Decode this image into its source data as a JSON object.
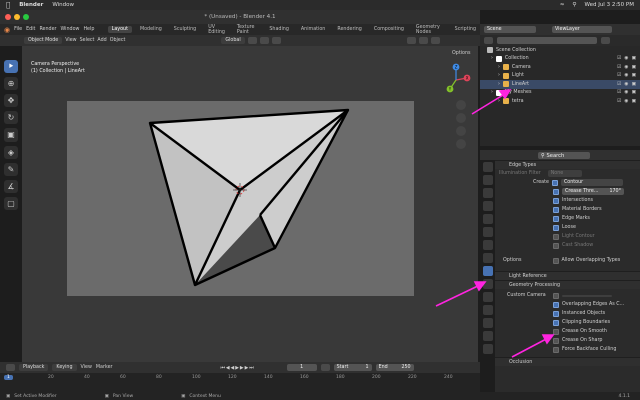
{
  "mac_menu": {
    "app": "Blender",
    "items": [
      "Window"
    ],
    "clock": "Wed Jul 3  2:50 PM"
  },
  "window": {
    "title": "* (Unsaved) - Blender 4.1"
  },
  "menubar": {
    "menus": [
      "File",
      "Edit",
      "Render",
      "Window",
      "Help"
    ],
    "workspaces": [
      "Layout",
      "Modeling",
      "Sculpting",
      "UV Editing",
      "Texture Paint",
      "Shading",
      "Animation",
      "Rendering",
      "Compositing",
      "Geometry Nodes",
      "Scripting"
    ],
    "active_workspace": "Layout",
    "scene": "Scene",
    "view_layer": "ViewLayer"
  },
  "viewport_header": {
    "mode": "Object Mode",
    "menus": [
      "View",
      "Select",
      "Add",
      "Object"
    ],
    "transform": "Global",
    "options": "Options"
  },
  "viewport": {
    "line1": "Camera Perspective",
    "line2": "(1) Collection | LineArt"
  },
  "gizmo": {
    "x": "X",
    "y": "Y",
    "z": "Z"
  },
  "timeline": {
    "menus": [
      "Playback",
      "Keying",
      "View",
      "Marker"
    ],
    "current_frame": "1",
    "start_label": "Start",
    "start": "1",
    "end_label": "End",
    "end": "250",
    "ticks": [
      "1",
      "20",
      "40",
      "60",
      "80",
      "100",
      "120",
      "140",
      "160",
      "180",
      "200",
      "220",
      "240"
    ]
  },
  "status": {
    "left": "Set Active Modifier",
    "mid": "Pan View",
    "right": "Context Menu",
    "version": "4.1.1"
  },
  "outliner": {
    "rows": [
      {
        "label": "Scene Collection",
        "indent": 0,
        "color": "#bbbbbb"
      },
      {
        "label": "Collection",
        "indent": 1,
        "color": "#ffffff"
      },
      {
        "label": "Camera",
        "indent": 2,
        "color": "#e8b14a"
      },
      {
        "label": "Light",
        "indent": 2,
        "color": "#e8b14a"
      },
      {
        "label": "LineArt",
        "indent": 2,
        "color": "#e8b14a"
      },
      {
        "label": "My Meshes",
        "indent": 1,
        "color": "#ffffff"
      },
      {
        "label": "tetra",
        "indent": 2,
        "color": "#e8b14a"
      }
    ]
  },
  "properties": {
    "search_placeholder": "Search",
    "edge_types_header": "Edge Types",
    "illum_label": "Illumination Filter",
    "illum_value": "None",
    "create_label": "Create",
    "contour": "Contour",
    "crease_label": "Crease Thre...",
    "crease_value": "170°",
    "edge_items": [
      "Intersections",
      "Material Borders",
      "Edge Marks",
      "Loose",
      "Light Contour",
      "Cast Shadow"
    ],
    "options_label": "Options",
    "allow_overlap": "Allow Overlapping Types",
    "light_ref": "Light Reference",
    "geo_proc": "Geometry Processing",
    "custom_camera": "Custom Camera",
    "geo_items": [
      "Overlapping Edges As C...",
      "Instanced Objects",
      "Clipping Boundaries",
      "Crease On Smooth",
      "Crease On Sharp",
      "Force Backface Culling"
    ],
    "next_header": "Occlusion"
  },
  "colors": {
    "accent": "#4772b3",
    "annotation": "#ff24e0",
    "camera_bg": "#6b6b6b"
  }
}
